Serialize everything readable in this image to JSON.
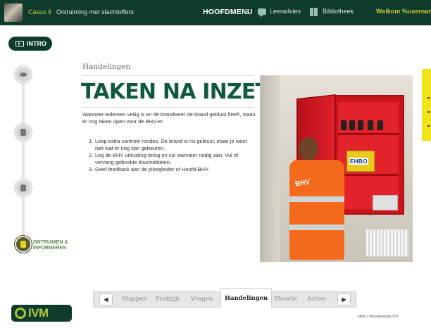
{
  "topbar": {
    "casus_label": "Casus 8",
    "casus_title": "Ontruiming met slachtoffers",
    "menu_label": "HOOFDMENU",
    "menu_chevron": "⌄",
    "advice_label": "Leeradvies",
    "library_label": "Bibliotheek",
    "welcome_text": "Welkom %username"
  },
  "intro_button": {
    "label": "INTRO"
  },
  "steps": {
    "active_label_line1": "ONTRUIMEN &",
    "active_label_line2": "INFORMEREN"
  },
  "content": {
    "section_label": "Handelingen",
    "headline": "TAKEN NA INZET",
    "intro": "Wanneer iedereen veilig is en de brandweer de brand geblust heeft, staan er nog taken open voor de BHV-er.",
    "list": [
      {
        "num": "1.",
        "text": "Loop extra controle rondes. De brand is nu geblust, maar je weet niet wat er nog kan gebeuren."
      },
      {
        "num": "2.",
        "text": "Leg de BHV uitrusting terug en vul wanneer nodig aan. Vul of vervang gebruikte blusmiddelen."
      },
      {
        "num": "3.",
        "text": "Geef feedback aan de ploegleider of Hoofd-BHV."
      }
    ]
  },
  "photo": {
    "ehbo_sign": "EHBO",
    "vest_text": "BHV"
  },
  "tabs": {
    "prev": "◀",
    "next": "▶",
    "items": [
      "Stappen",
      "Praktijk",
      "Vragen",
      "Handelingen",
      "Theorie",
      "Acties"
    ],
    "active": "Handelingen"
  },
  "footer": {
    "logo_text": "IVM",
    "links": "Help | Voorleeshulp UIT"
  },
  "colors": {
    "brand_dark": "#0f3b2c",
    "brand_lime": "#a9c63a",
    "headline_green": "#0f5a3e",
    "highlight_yellow": "#f2e31b"
  }
}
